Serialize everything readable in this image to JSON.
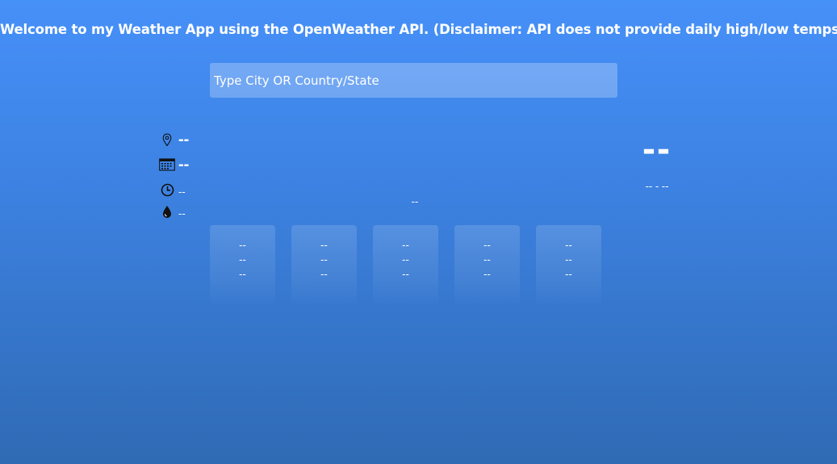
{
  "header": {
    "title": "Welcome to my Weather App using the OpenWeather API. (Disclaimer: API does not provide daily high/low temps)"
  },
  "search": {
    "placeholder": "Type City OR Country/State",
    "value": ""
  },
  "current": {
    "location": "--",
    "date": "--",
    "time": "--",
    "humidity": "--",
    "condition": "--",
    "temperature": "--",
    "high_low": "-- - --"
  },
  "icons": {
    "location": "map-pin-icon",
    "date": "calendar-icon",
    "time": "clock-icon",
    "humidity": "water-drop-icon"
  },
  "forecast": [
    {
      "line1": "--",
      "line2": "--",
      "line3": "--"
    },
    {
      "line1": "--",
      "line2": "--",
      "line3": "--"
    },
    {
      "line1": "--",
      "line2": "--",
      "line3": "--"
    },
    {
      "line1": "--",
      "line2": "--",
      "line3": "--"
    },
    {
      "line1": "--",
      "line2": "--",
      "line3": "--"
    }
  ],
  "colors": {
    "background_top": "#4690f9",
    "background_bottom": "#2f6ab4",
    "text": "#ffffff",
    "icon": "#111111"
  }
}
